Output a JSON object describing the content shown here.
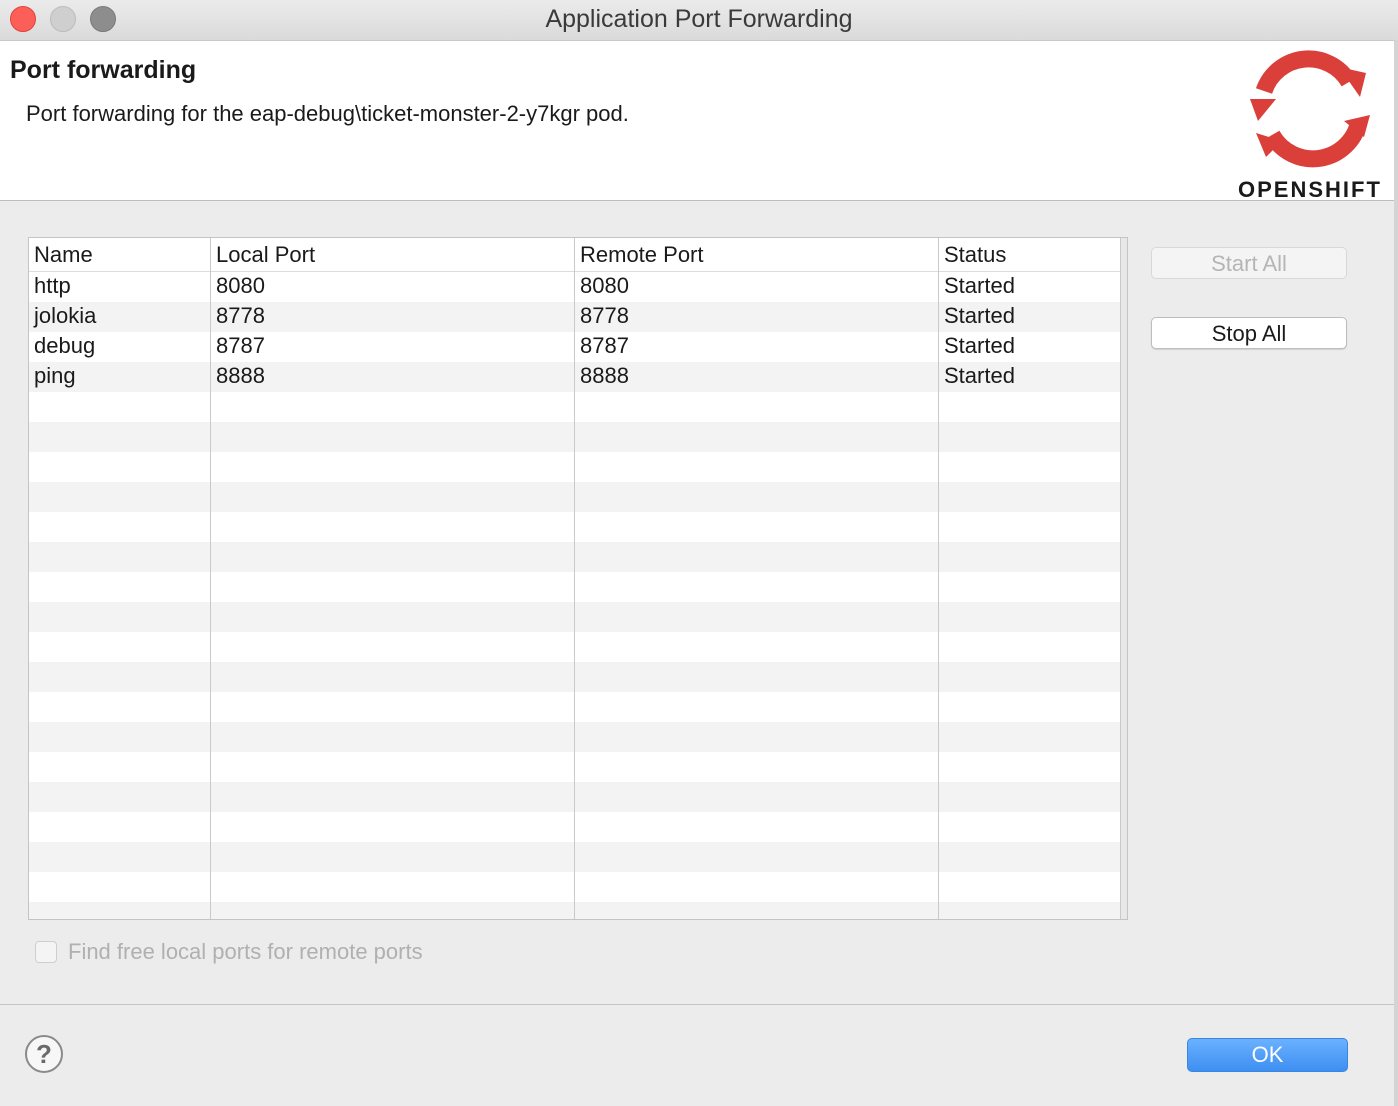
{
  "window": {
    "title": "Application Port Forwarding"
  },
  "header": {
    "title": "Port forwarding",
    "description": "Port forwarding for the eap-debug\\ticket-monster-2-y7kgr pod.",
    "logo_text": "OPENSHIFT",
    "logo_color": "#db3f3a"
  },
  "table": {
    "columns": [
      "Name",
      "Local Port",
      "Remote Port",
      "Status"
    ],
    "rows": [
      {
        "name": "http",
        "local_port": "8080",
        "remote_port": "8080",
        "status": "Started"
      },
      {
        "name": "jolokia",
        "local_port": "8778",
        "remote_port": "8778",
        "status": "Started"
      },
      {
        "name": "debug",
        "local_port": "8787",
        "remote_port": "8787",
        "status": "Started"
      },
      {
        "name": "ping",
        "local_port": "8888",
        "remote_port": "8888",
        "status": "Started"
      }
    ]
  },
  "buttons": {
    "start_all": "Start All",
    "stop_all": "Stop All",
    "ok": "OK"
  },
  "options": {
    "find_free_ports_label": "Find free local ports for remote ports",
    "find_free_ports_checked": false
  },
  "help": {
    "icon": "question-icon",
    "glyph": "?"
  },
  "colors": {
    "accent": "#3e8ff2"
  }
}
